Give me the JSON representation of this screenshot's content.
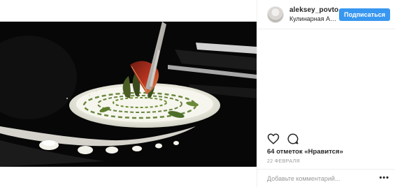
{
  "post": {
    "image_alt_icon": "plated-dish-photo",
    "header": {
      "username": "aleksey_povtoreyk",
      "location": "Кулинарная Ака...",
      "follow_label": "Подписаться",
      "follow_color": "#3897f0"
    },
    "actions": {
      "like_icon": "heart-icon",
      "comment_icon": "comment-icon"
    },
    "likes_text": "64 отметок «Нравится»",
    "date_text": "22 ФЕВРАЛЯ",
    "comment": {
      "placeholder": "Добавьте комментарий...",
      "more_icon": "more-options-icon",
      "more_label": "•••"
    }
  }
}
